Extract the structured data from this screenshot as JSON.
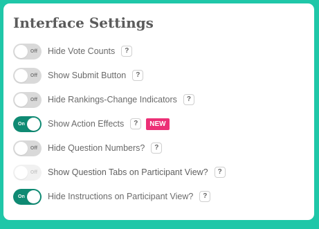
{
  "panel": {
    "title": "Interface Settings"
  },
  "settings": [
    {
      "label": "Hide Vote Counts",
      "state": "Off",
      "on": false,
      "disabled": false
    },
    {
      "label": "Show Submit Button",
      "state": "Off",
      "on": false,
      "disabled": false
    },
    {
      "label": "Hide Rankings-Change Indicators",
      "state": "Off",
      "on": false,
      "disabled": false
    },
    {
      "label": "Show Action Effects",
      "state": "On",
      "on": true,
      "disabled": false,
      "badge": "NEW"
    },
    {
      "label": "Hide Question Numbers?",
      "state": "Off",
      "on": false,
      "disabled": false
    },
    {
      "label": "Show Question Tabs on Participant View?",
      "state": "Off",
      "on": false,
      "disabled": true
    },
    {
      "label": "Hide Instructions on Participant View?",
      "state": "On",
      "on": true,
      "disabled": false
    }
  ],
  "help_glyph": "?",
  "icons": {
    "help": "question-mark-icon"
  },
  "colors": {
    "background": "#1fc7a8",
    "toggle_on": "#0f8a73",
    "toggle_off": "#d9d9d9",
    "badge": "#ec2f76"
  }
}
